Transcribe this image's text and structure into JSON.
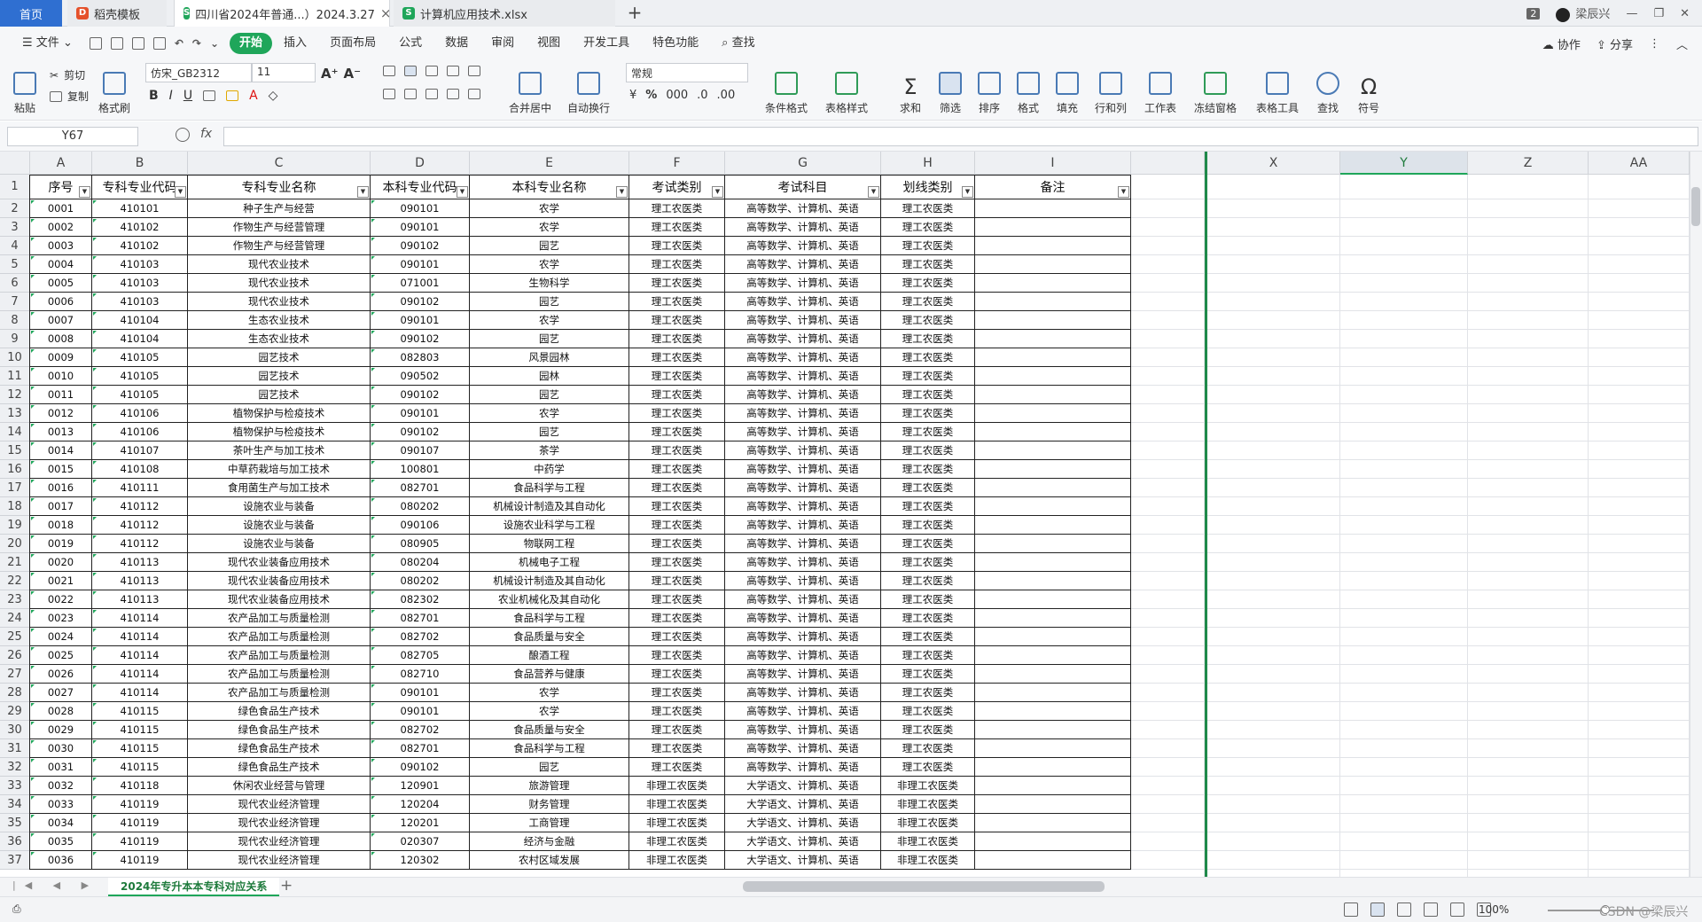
{
  "tabs": {
    "home": "首页",
    "template": "稻壳模板",
    "doc1": "四川省2024年普通...）2024.3.27",
    "doc2": "计算机应用技术.xlsx",
    "user": "梁辰兴",
    "count": "2"
  },
  "menu": {
    "file": "文件",
    "items": [
      "开始",
      "插入",
      "页面布局",
      "公式",
      "数据",
      "审阅",
      "视图",
      "开发工具",
      "特色功能"
    ],
    "search": "查找",
    "collab": "协作",
    "share": "分享"
  },
  "ribbon": {
    "paste": "粘贴",
    "cut": "剪切",
    "copy": "复制",
    "format_painter": "格式刷",
    "font_name": "仿宋_GB2312",
    "font_size": "11",
    "merge_center": "合并居中",
    "wrap": "自动换行",
    "number_format": "常规",
    "cond_format": "条件格式",
    "table_style": "表格样式",
    "sum": "求和",
    "filter": "筛选",
    "sort": "排序",
    "format": "格式",
    "fill": "填充",
    "rowcol": "行和列",
    "worksheet": "工作表",
    "freeze": "冻结窗格",
    "table_tools": "表格工具",
    "find": "查找",
    "symbol": "符号"
  },
  "formula_bar": {
    "name_box": "Y67",
    "fx": "fx",
    "content": ""
  },
  "columns_left": [
    "A",
    "B",
    "C",
    "D",
    "E",
    "F",
    "G",
    "H",
    "I"
  ],
  "columns_right": [
    "X",
    "Y",
    "Z",
    "AA"
  ],
  "header_row": [
    "序号",
    "专科专业代码",
    "专科专业名称",
    "本科专业代码",
    "本科专业名称",
    "考试类别",
    "考试科目",
    "划线类别",
    "备注"
  ],
  "rows": [
    [
      "0001",
      "410101",
      "种子生产与经营",
      "090101",
      "农学",
      "理工农医类",
      "高等数学、计算机、英语",
      "理工农医类",
      ""
    ],
    [
      "0002",
      "410102",
      "作物生产与经营管理",
      "090101",
      "农学",
      "理工农医类",
      "高等数学、计算机、英语",
      "理工农医类",
      ""
    ],
    [
      "0003",
      "410102",
      "作物生产与经营管理",
      "090102",
      "园艺",
      "理工农医类",
      "高等数学、计算机、英语",
      "理工农医类",
      ""
    ],
    [
      "0004",
      "410103",
      "现代农业技术",
      "090101",
      "农学",
      "理工农医类",
      "高等数学、计算机、英语",
      "理工农医类",
      ""
    ],
    [
      "0005",
      "410103",
      "现代农业技术",
      "071001",
      "生物科学",
      "理工农医类",
      "高等数学、计算机、英语",
      "理工农医类",
      ""
    ],
    [
      "0006",
      "410103",
      "现代农业技术",
      "090102",
      "园艺",
      "理工农医类",
      "高等数学、计算机、英语",
      "理工农医类",
      ""
    ],
    [
      "0007",
      "410104",
      "生态农业技术",
      "090101",
      "农学",
      "理工农医类",
      "高等数学、计算机、英语",
      "理工农医类",
      ""
    ],
    [
      "0008",
      "410104",
      "生态农业技术",
      "090102",
      "园艺",
      "理工农医类",
      "高等数学、计算机、英语",
      "理工农医类",
      ""
    ],
    [
      "0009",
      "410105",
      "园艺技术",
      "082803",
      "风景园林",
      "理工农医类",
      "高等数学、计算机、英语",
      "理工农医类",
      ""
    ],
    [
      "0010",
      "410105",
      "园艺技术",
      "090502",
      "园林",
      "理工农医类",
      "高等数学、计算机、英语",
      "理工农医类",
      ""
    ],
    [
      "0011",
      "410105",
      "园艺技术",
      "090102",
      "园艺",
      "理工农医类",
      "高等数学、计算机、英语",
      "理工农医类",
      ""
    ],
    [
      "0012",
      "410106",
      "植物保护与检疫技术",
      "090101",
      "农学",
      "理工农医类",
      "高等数学、计算机、英语",
      "理工农医类",
      ""
    ],
    [
      "0013",
      "410106",
      "植物保护与检疫技术",
      "090102",
      "园艺",
      "理工农医类",
      "高等数学、计算机、英语",
      "理工农医类",
      ""
    ],
    [
      "0014",
      "410107",
      "茶叶生产与加工技术",
      "090107",
      "茶学",
      "理工农医类",
      "高等数学、计算机、英语",
      "理工农医类",
      ""
    ],
    [
      "0015",
      "410108",
      "中草药栽培与加工技术",
      "100801",
      "中药学",
      "理工农医类",
      "高等数学、计算机、英语",
      "理工农医类",
      ""
    ],
    [
      "0016",
      "410111",
      "食用菌生产与加工技术",
      "082701",
      "食品科学与工程",
      "理工农医类",
      "高等数学、计算机、英语",
      "理工农医类",
      ""
    ],
    [
      "0017",
      "410112",
      "设施农业与装备",
      "080202",
      "机械设计制造及其自动化",
      "理工农医类",
      "高等数学、计算机、英语",
      "理工农医类",
      ""
    ],
    [
      "0018",
      "410112",
      "设施农业与装备",
      "090106",
      "设施农业科学与工程",
      "理工农医类",
      "高等数学、计算机、英语",
      "理工农医类",
      ""
    ],
    [
      "0019",
      "410112",
      "设施农业与装备",
      "080905",
      "物联网工程",
      "理工农医类",
      "高等数学、计算机、英语",
      "理工农医类",
      ""
    ],
    [
      "0020",
      "410113",
      "现代农业装备应用技术",
      "080204",
      "机械电子工程",
      "理工农医类",
      "高等数学、计算机、英语",
      "理工农医类",
      ""
    ],
    [
      "0021",
      "410113",
      "现代农业装备应用技术",
      "080202",
      "机械设计制造及其自动化",
      "理工农医类",
      "高等数学、计算机、英语",
      "理工农医类",
      ""
    ],
    [
      "0022",
      "410113",
      "现代农业装备应用技术",
      "082302",
      "农业机械化及其自动化",
      "理工农医类",
      "高等数学、计算机、英语",
      "理工农医类",
      ""
    ],
    [
      "0023",
      "410114",
      "农产品加工与质量检测",
      "082701",
      "食品科学与工程",
      "理工农医类",
      "高等数学、计算机、英语",
      "理工农医类",
      ""
    ],
    [
      "0024",
      "410114",
      "农产品加工与质量检测",
      "082702",
      "食品质量与安全",
      "理工农医类",
      "高等数学、计算机、英语",
      "理工农医类",
      ""
    ],
    [
      "0025",
      "410114",
      "农产品加工与质量检测",
      "082705",
      "酿酒工程",
      "理工农医类",
      "高等数学、计算机、英语",
      "理工农医类",
      ""
    ],
    [
      "0026",
      "410114",
      "农产品加工与质量检测",
      "082710",
      "食品营养与健康",
      "理工农医类",
      "高等数学、计算机、英语",
      "理工农医类",
      ""
    ],
    [
      "0027",
      "410114",
      "农产品加工与质量检测",
      "090101",
      "农学",
      "理工农医类",
      "高等数学、计算机、英语",
      "理工农医类",
      ""
    ],
    [
      "0028",
      "410115",
      "绿色食品生产技术",
      "090101",
      "农学",
      "理工农医类",
      "高等数学、计算机、英语",
      "理工农医类",
      ""
    ],
    [
      "0029",
      "410115",
      "绿色食品生产技术",
      "082702",
      "食品质量与安全",
      "理工农医类",
      "高等数学、计算机、英语",
      "理工农医类",
      ""
    ],
    [
      "0030",
      "410115",
      "绿色食品生产技术",
      "082701",
      "食品科学与工程",
      "理工农医类",
      "高等数学、计算机、英语",
      "理工农医类",
      ""
    ],
    [
      "0031",
      "410115",
      "绿色食品生产技术",
      "090102",
      "园艺",
      "理工农医类",
      "高等数学、计算机、英语",
      "理工农医类",
      ""
    ],
    [
      "0032",
      "410118",
      "休闲农业经营与管理",
      "120901",
      "旅游管理",
      "非理工农医类",
      "大学语文、计算机、英语",
      "非理工农医类",
      ""
    ],
    [
      "0033",
      "410119",
      "现代农业经济管理",
      "120204",
      "财务管理",
      "非理工农医类",
      "大学语文、计算机、英语",
      "非理工农医类",
      ""
    ],
    [
      "0034",
      "410119",
      "现代农业经济管理",
      "120201",
      "工商管理",
      "非理工农医类",
      "大学语文、计算机、英语",
      "非理工农医类",
      ""
    ],
    [
      "0035",
      "410119",
      "现代农业经济管理",
      "020307",
      "经济与金融",
      "非理工农医类",
      "大学语文、计算机、英语",
      "非理工农医类",
      ""
    ],
    [
      "0036",
      "410119",
      "现代农业经济管理",
      "120302",
      "农村区域发展",
      "非理工农医类",
      "大学语文、计算机、英语",
      "非理工农医类",
      ""
    ]
  ],
  "sheet_tab": "2024年专升本本专科对应关系",
  "status": {
    "zoom": "100%",
    "watermark": "CSDN @梁辰兴"
  },
  "colors": {
    "accent": "#1fa65a",
    "home_tab": "#2f6fd1"
  }
}
